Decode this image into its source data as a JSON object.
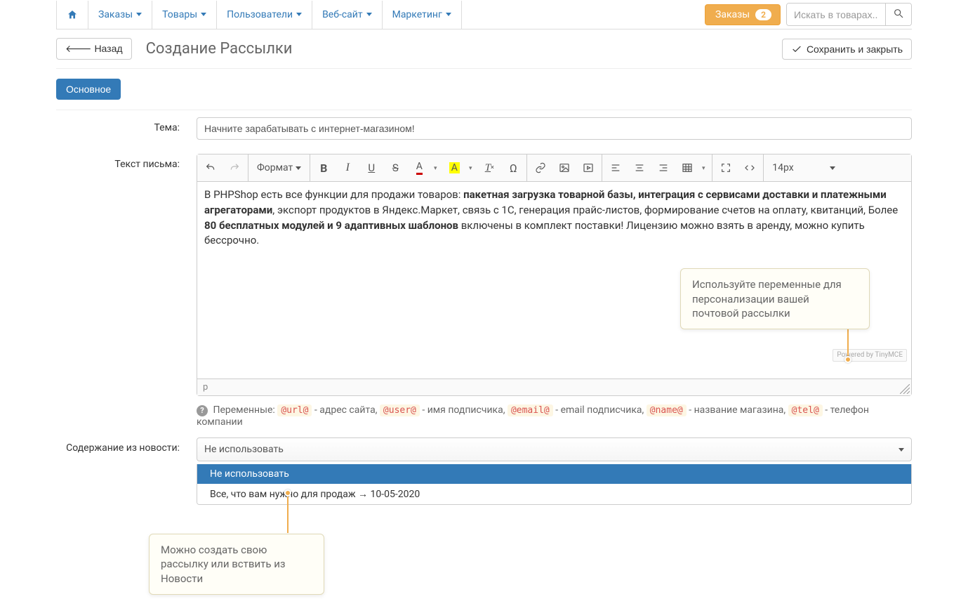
{
  "nav": {
    "items": [
      "Заказы",
      "Товары",
      "Пользователи",
      "Веб-сайт",
      "Маркетинг"
    ],
    "orders_label": "Заказы",
    "orders_badge": "2",
    "search_placeholder": "Искать в товарах..."
  },
  "header": {
    "back_label": "Назад",
    "page_title": "Создание Рассылки",
    "save_label": "Сохранить и закрыть"
  },
  "tabs": {
    "main": "Основное"
  },
  "form": {
    "subject_label": "Тема:",
    "subject_value": "Начните зарабатывать с интернет-магазином!",
    "body_label": "Текст письма:",
    "news_label": "Содержание из новости:"
  },
  "editor": {
    "format_label": "Формат",
    "fontsize": "14px",
    "path": "p",
    "powered": "Powered by TinyMCE",
    "content_parts": {
      "p1": "В PHPShop есть все функции для продажи товаров: ",
      "b1": "пакетная загрузка товарной базы, интеграция с сервисами доставки и платежными агрегаторами",
      "p2": ", экспорт продуктов в Яндекс.Маркет, связь с 1C, генерация прайс-листов, формирование счетов на оплату, квитанций, Более ",
      "b2": "80 бесплатных модулей и 9 адаптивных шаблонов",
      "p3": " включены в комплект поставки! Лицензию можно взять в аренду, можно купить бессрочно."
    }
  },
  "vars_hint": {
    "prefix": "Переменные:",
    "url_var": "@url@",
    "url_desc": " - адрес сайта, ",
    "user_var": "@user@",
    "user_desc": " - имя подписчика, ",
    "email_var": "@email@",
    "email_desc": " - email подписчика, ",
    "name_var": "@name@",
    "name_desc": " - название магазина, ",
    "tel_var": "@tel@",
    "tel_desc": " - телефон компании"
  },
  "news_select": {
    "selected": "Не использовать",
    "options": [
      "Не использовать",
      "Все, что вам нужно для продаж → 10-05-2020"
    ]
  },
  "tooltips": {
    "vars": "Используйте переменные для персонализации вашей почтовой рассылки",
    "news": "Можно создать свою рассылку или вствить из Новости"
  }
}
